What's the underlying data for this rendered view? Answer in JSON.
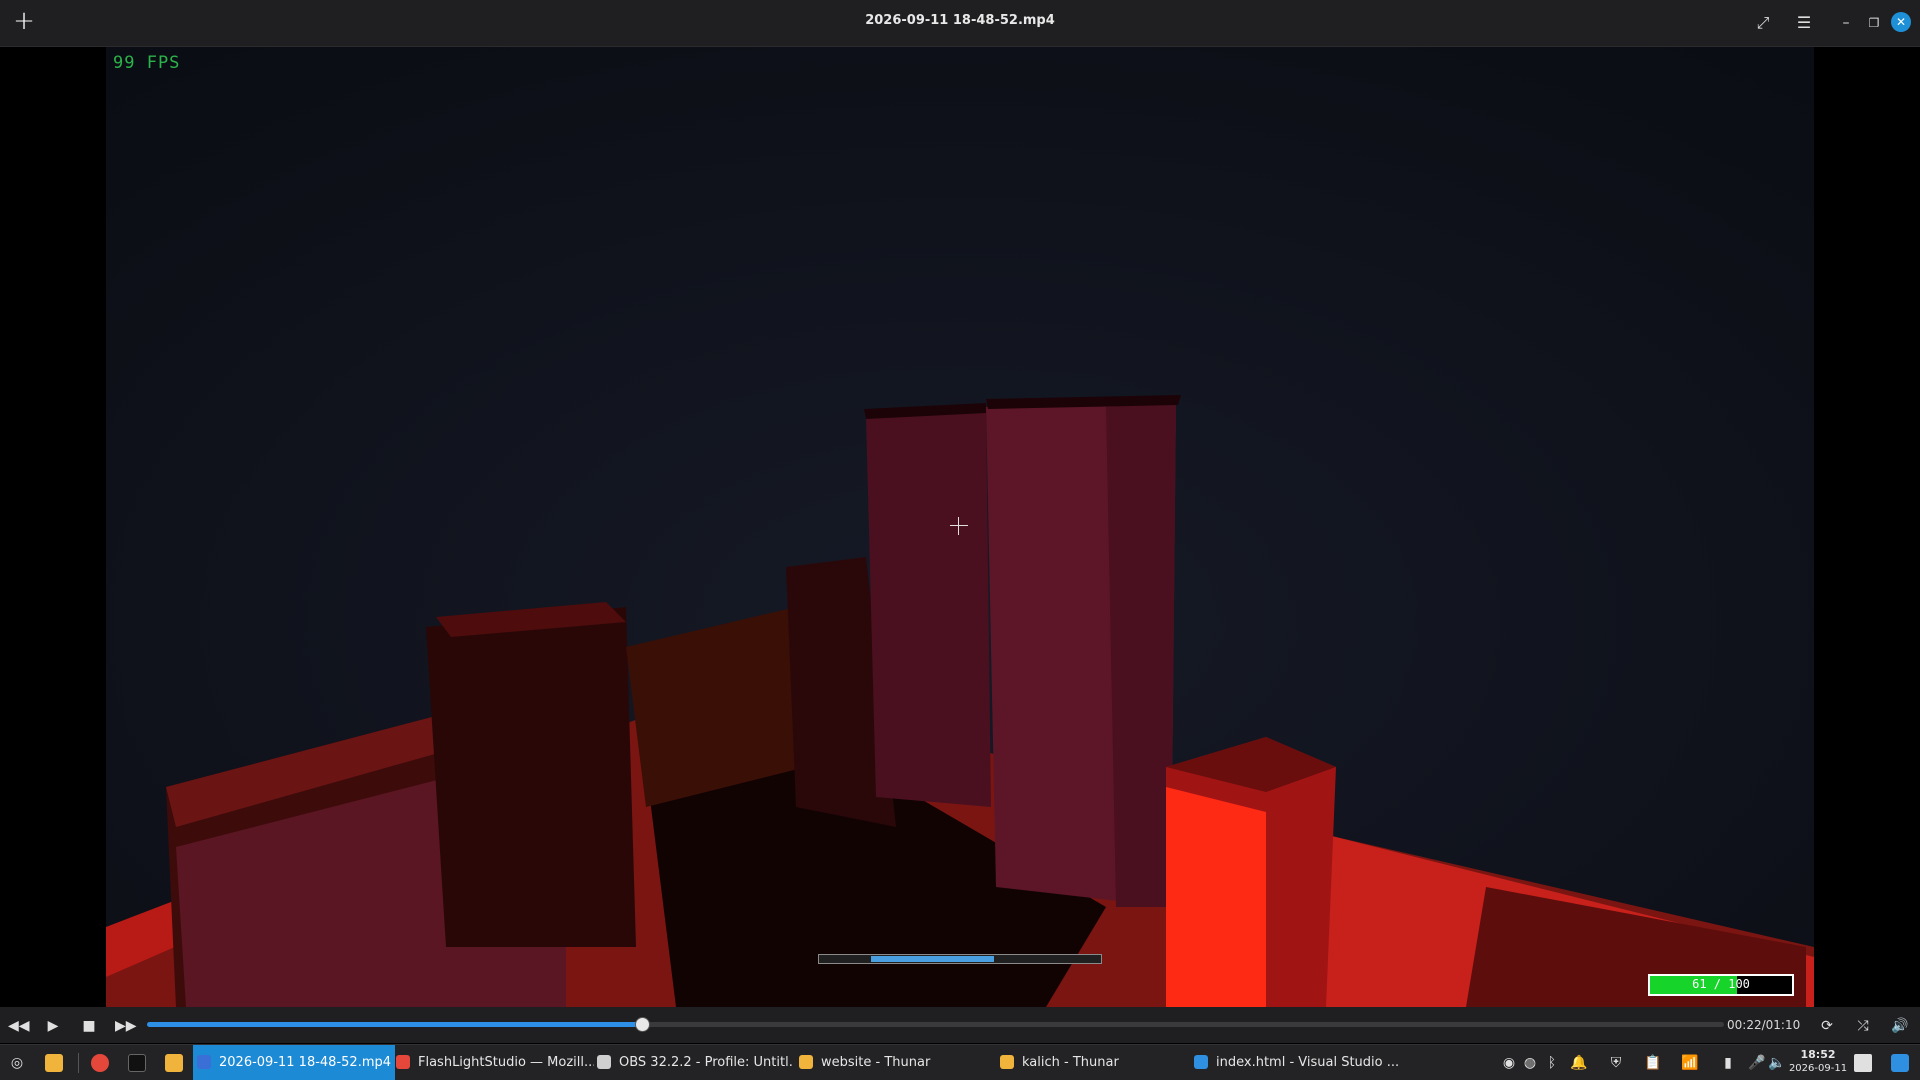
{
  "window": {
    "title": "2026-09-11 18-48-52.mp4",
    "new_tab_icon": "plus-icon",
    "buttons": [
      "fullscreen-icon",
      "menu-icon",
      "minimize-icon",
      "maximize-icon",
      "close-icon"
    ]
  },
  "overlay": {
    "fps": "99 FPS",
    "loading_progress": 0.62,
    "health_label": "61 / 100",
    "health_fraction": 0.61
  },
  "player": {
    "timecode": "00:22/01:10",
    "position_fraction": 0.314,
    "accent_color": "#2e8fe6"
  },
  "taskbar": {
    "tasks": [
      {
        "label": "2026-09-11 18-48-52.mp4",
        "active": true,
        "color": "#3a6fd8"
      },
      {
        "label": "FlashLightStudio — Mozill...",
        "active": false,
        "color": "#e5483b"
      },
      {
        "label": "OBS 32.2.2 - Profile: Untitl...",
        "active": false,
        "color": "#cfcfcf"
      },
      {
        "label": "website - Thunar",
        "active": false,
        "color": "#f0b43c"
      },
      {
        "label": "kalich - Thunar",
        "active": false,
        "color": "#f0b43c"
      },
      {
        "label": "index.html - Visual Studio ...",
        "active": false,
        "color": "#2f8fe0"
      }
    ],
    "clock": {
      "time": "18:52",
      "date": "2026-09-11"
    }
  }
}
